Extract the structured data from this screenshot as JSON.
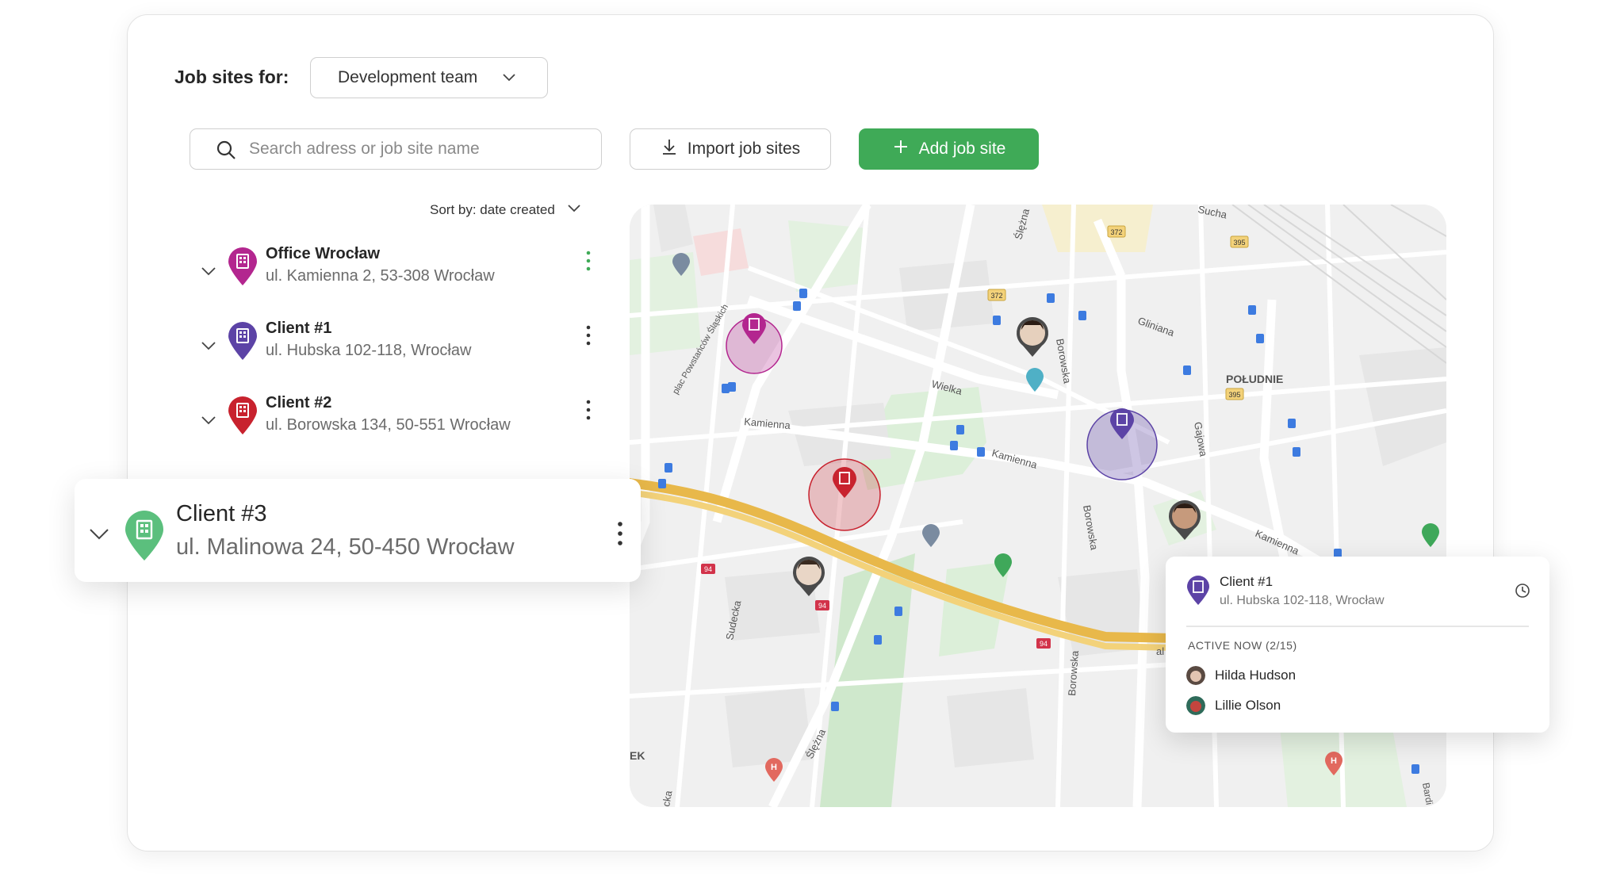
{
  "header": {
    "jobsites_label": "Job sites for:",
    "team_select": "Development team"
  },
  "toolbar": {
    "search_placeholder": "Search adress or job site name",
    "import_label": "Import job sites",
    "add_label": "Add job site"
  },
  "sort": {
    "label": "Sort by: date created"
  },
  "sites": [
    {
      "name": "Office Wrocław",
      "address": "ul. Kamienna 2, 53-308 Wrocław",
      "color": "#b3268f"
    },
    {
      "name": "Client #1",
      "address": "ul. Hubska 102-118, Wrocław",
      "color": "#5c43a6"
    },
    {
      "name": "Client #2",
      "address": "ul. Borowska 134, 50-551 Wrocław",
      "color": "#c8222e"
    }
  ],
  "selected_site": {
    "name": "Client #3",
    "address": "ul. Malinowa 24, 50-450 Wrocław",
    "color": "#5bbf7d"
  },
  "map_labels": {
    "sucha": "Sucha",
    "slezna_top": "Ślężna",
    "gliniana": "Gliniana",
    "poludnie": "POŁUDNIE",
    "wielka": "Wielka",
    "borowska_top": "Borowska",
    "kamienna_left": "Kamienna",
    "kamienna_mid": "Kamienna",
    "kamienna_right": "Kamienna",
    "gajowa": "Gajowa",
    "plac": "plac Powstańców Śląskich",
    "borowska_mid": "Borowska",
    "sudecka": "Sudecka",
    "borowska_low": "Borowska",
    "slezna_low": "Ślężna",
    "ek": "EK",
    "r372a": "372",
    "r372b": "372",
    "r395a": "395",
    "r395b": "395",
    "r94a": "94",
    "r94b": "94",
    "r94c": "94",
    "al": "al",
    "bard": "Bardi",
    "cka": "cka"
  },
  "popup": {
    "name": "Client #1",
    "address": "ul. Hubska 102-118, Wrocław",
    "active_label": "ACTIVE NOW (2/15)",
    "people": [
      "Hilda Hudson",
      "Lillie Olson"
    ]
  },
  "colors": {
    "accent_green": "#3faa57",
    "office_magenta": "#b3268f",
    "client1_purple": "#5c43a6",
    "client2_red": "#c8222e",
    "client3_green": "#5bbf7d"
  }
}
